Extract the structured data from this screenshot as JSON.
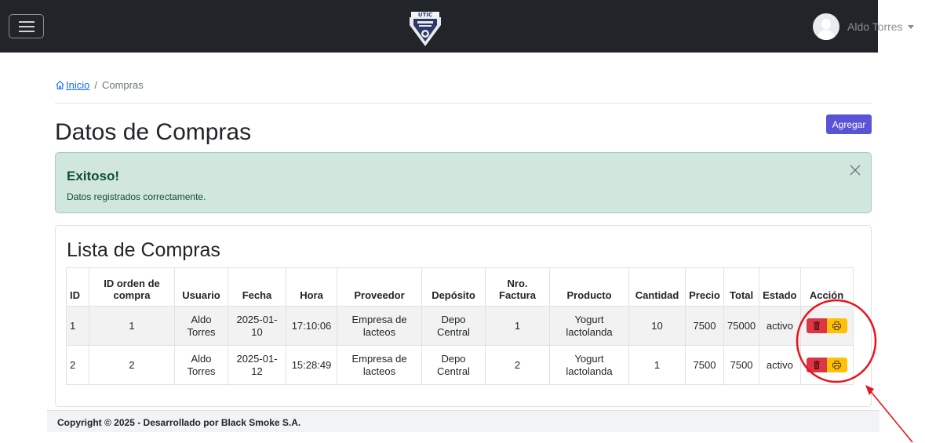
{
  "header": {
    "logo_text": "UTIC",
    "user_name": "Aldo Torres"
  },
  "breadcrumb": {
    "home_label": "Inicio",
    "separator": "/",
    "current": "Compras"
  },
  "page": {
    "title": "Datos de Compras",
    "add_label": "Agregar"
  },
  "alert": {
    "title": "Exitoso!",
    "message": "Datos registrados correctamente."
  },
  "card": {
    "title": "Lista de Compras"
  },
  "table": {
    "headers": [
      "ID",
      "ID orden de compra",
      "Usuario",
      "Fecha",
      "Hora",
      "Proveedor",
      "Depósito",
      "Nro. Factura",
      "Producto",
      "Cantidad",
      "Precio",
      "Total",
      "Estado",
      "Acción"
    ],
    "rows": [
      {
        "id": "1",
        "orden": "1",
        "usuario": "Aldo Torres",
        "fecha": "2025-01-10",
        "hora": "17:10:06",
        "proveedor": "Empresa de lacteos",
        "deposito": "Depo Central",
        "factura": "1",
        "producto": "Yogurt lactolanda",
        "cantidad": "10",
        "precio": "7500",
        "total": "75000",
        "estado": "activo"
      },
      {
        "id": "2",
        "orden": "2",
        "usuario": "Aldo Torres",
        "fecha": "2025-01-12",
        "hora": "15:28:49",
        "proveedor": "Empresa de lacteos",
        "deposito": "Depo Central",
        "factura": "2",
        "producto": "Yogurt lactolanda",
        "cantidad": "1",
        "precio": "7500",
        "total": "7500",
        "estado": "activo"
      }
    ]
  },
  "footer": {
    "text": "Copyright © 2025 - Desarrollado por Black Smoke S.A."
  },
  "colors": {
    "navbar": "#212529",
    "primary": "#5b53d6",
    "success_bg": "#d1e7dd",
    "success_text": "#0f5132",
    "danger": "#dc3545",
    "warning": "#ffc107",
    "annotation": "#e8141a"
  },
  "icons": {
    "menu": "hamburger-icon",
    "home": "home-icon",
    "close": "close-icon",
    "delete": "trash-icon",
    "print": "printer-icon"
  }
}
